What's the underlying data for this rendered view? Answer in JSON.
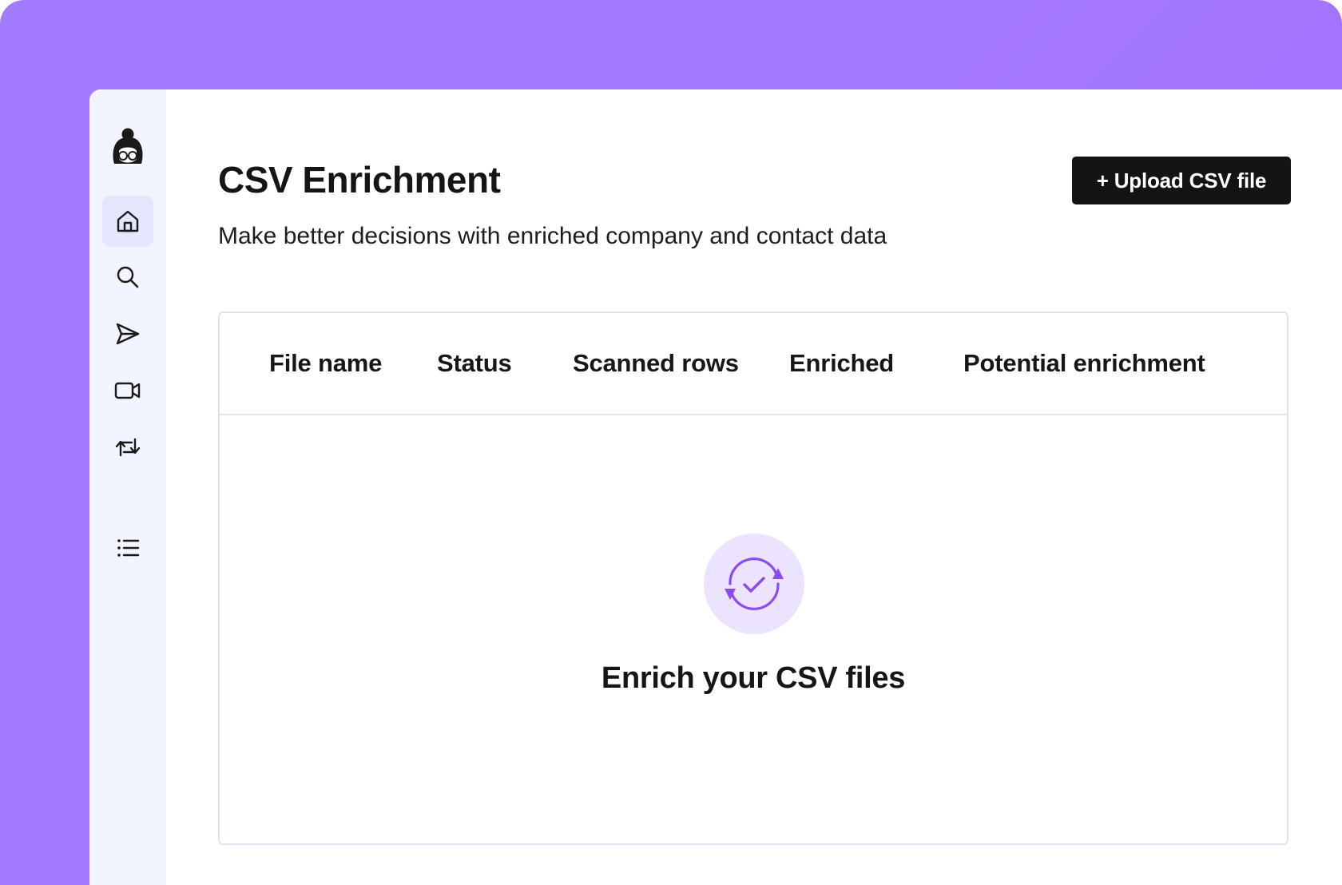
{
  "app": {
    "accent_color": "#a27bff",
    "sidebar_bg": "#f2f4ff",
    "active_item_bg": "#e3e6fd"
  },
  "sidebar": {
    "logo_icon": "avatar-logo-icon",
    "items": [
      {
        "icon": "home-icon",
        "active": true
      },
      {
        "icon": "search-icon",
        "active": false
      },
      {
        "icon": "send-icon",
        "active": false
      },
      {
        "icon": "video-icon",
        "active": false
      },
      {
        "icon": "repeat-icon",
        "active": false
      },
      {
        "icon": "list-icon",
        "active": false
      }
    ]
  },
  "page": {
    "title": "CSV Enrichment",
    "subtitle": "Make better decisions with enriched company and contact data",
    "upload_button_label": "+ Upload CSV file"
  },
  "table": {
    "columns": [
      "File name",
      "Status",
      "Scanned rows",
      "Enriched",
      "Potential enrichment"
    ],
    "rows": []
  },
  "empty_state": {
    "icon": "sync-check-icon",
    "title": "Enrich your CSV files"
  }
}
